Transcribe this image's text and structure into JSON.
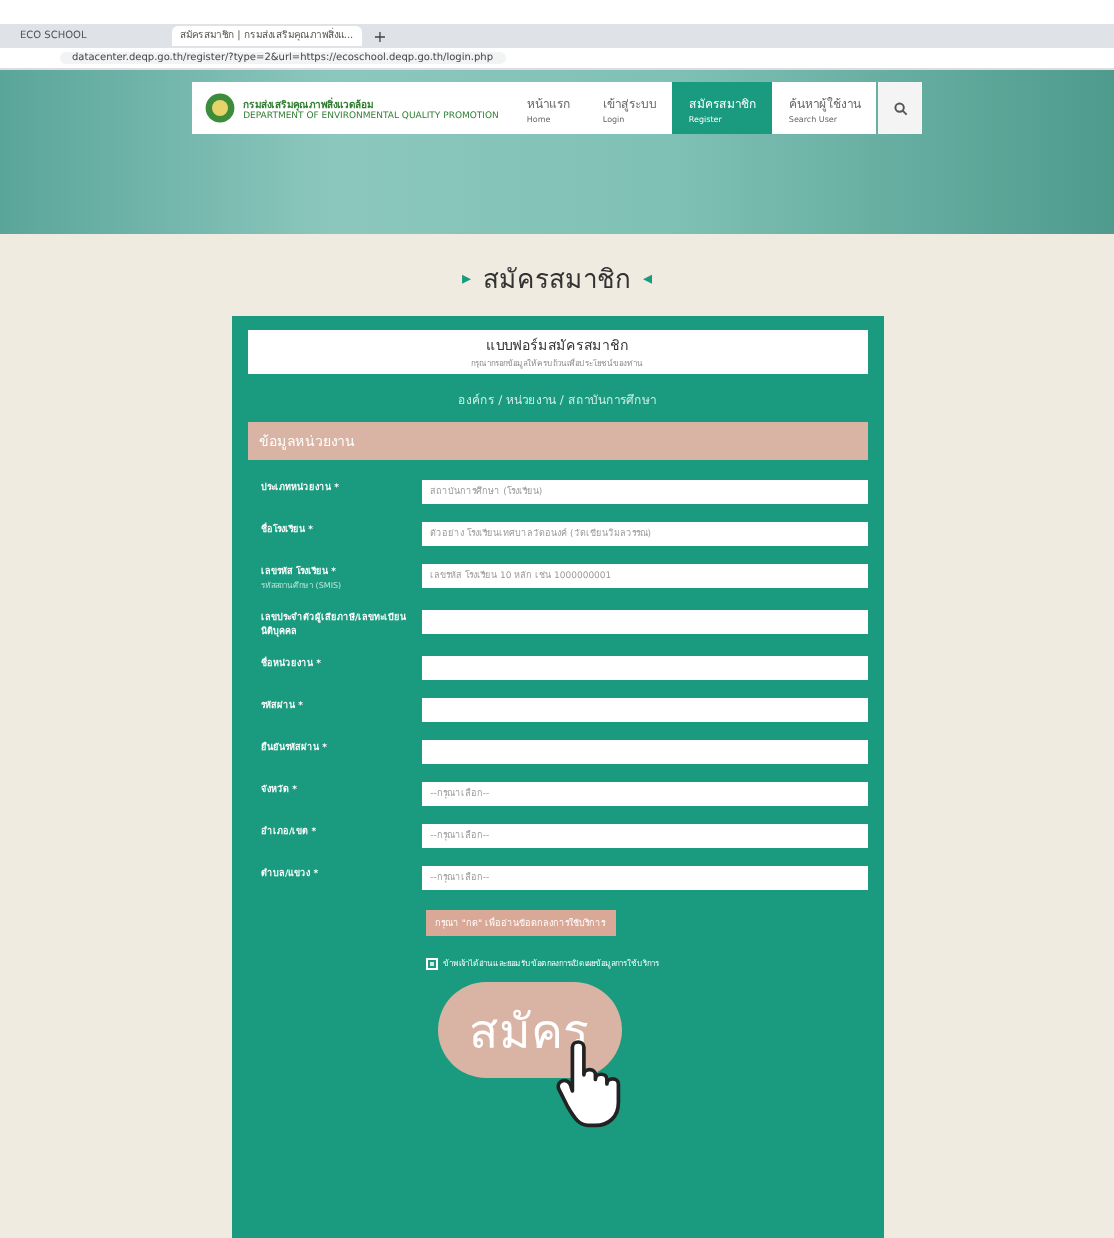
{
  "browser": {
    "tabs": [
      {
        "title": "ECO SCHOOL",
        "selected": false
      },
      {
        "title": "สมัครสมาชิก | กรมส่งเสริมคุณภาพสิ่งแ...",
        "selected": true
      }
    ],
    "new_tab": "+",
    "url": "datacenter.deqp.go.th/register/?type=2&url=https://ecoschool.deqp.go.th/login.php"
  },
  "site": {
    "logo_title": "กรมส่งเสริมคุณภาพสิ่งแวดล้อม",
    "logo_subtitle": "DEPARTMENT OF ENVIRONMENTAL QUALITY PROMOTION",
    "nav": [
      {
        "label": "หน้าแรก",
        "sub": "Home",
        "selected": false
      },
      {
        "label": "เข้าสู่ระบบ",
        "sub": "Login",
        "selected": false
      },
      {
        "label": "สมัครสมาชิก",
        "sub": "Register",
        "selected": true
      },
      {
        "label": "ค้นหาผู้ใช้งาน",
        "sub": "Search User",
        "selected": false
      }
    ]
  },
  "page_title": {
    "left": "▸",
    "text": "สมัครสมาชิก",
    "right": "◂"
  },
  "form": {
    "title": "แบบฟอร์มสมัครสมาชิก",
    "subtitle": "กรุณากรอกข้อมูลให้ครบถ้วนเพื่อประโยชน์ของท่าน",
    "category": "องค์กร / หน่วยงาน / สถาบันการศึกษา",
    "section": "ข้อมูลหน่วยงาน",
    "fields": [
      {
        "label": "ประเภทหน่วยงาน *",
        "placeholder": "สถาบันการศึกษา (โรงเรียน)"
      },
      {
        "label": "ชื่อโรงเรียน *",
        "placeholder": "ตัวอย่าง โรงเรียนเทศบาลวัดอนงค์ (วัดเขียนวิมลวรรณ)"
      },
      {
        "label": "เลขรหัส โรงเรียน *",
        "sub": "รหัสสถานศึกษา (SMIS)",
        "placeholder": "เลขรหัส โรงเรียน 10 หลัก เช่น 1000000001"
      },
      {
        "label": "เลขประจำตัวผู้เสียภาษี/เลขทะเบียนนิติบุคคล"
      },
      {
        "label": "ชื่อหน่วยงาน *"
      },
      {
        "label": "รหัสผ่าน *"
      },
      {
        "label": "ยืนยันรหัสผ่าน *"
      },
      {
        "label": "จังหวัด *",
        "placeholder": "--กรุณาเลือก--"
      },
      {
        "label": "อำเภอ/เขต *",
        "placeholder": "--กรุณาเลือก--"
      },
      {
        "label": "ตำบล/แขวง *",
        "placeholder": "--กรุณาเลือก--"
      }
    ],
    "terms_button": "กรุณา \"กด\" เพื่ออ่านข้อตกลงการใช้บริการ",
    "agree": {
      "label": "ข้าพเจ้าได้อ่านและยอมรับข้อตกลงการเปิดเผยข้อมูลการใช้บริการ",
      "checked": true
    },
    "submit": "สมัคร"
  }
}
